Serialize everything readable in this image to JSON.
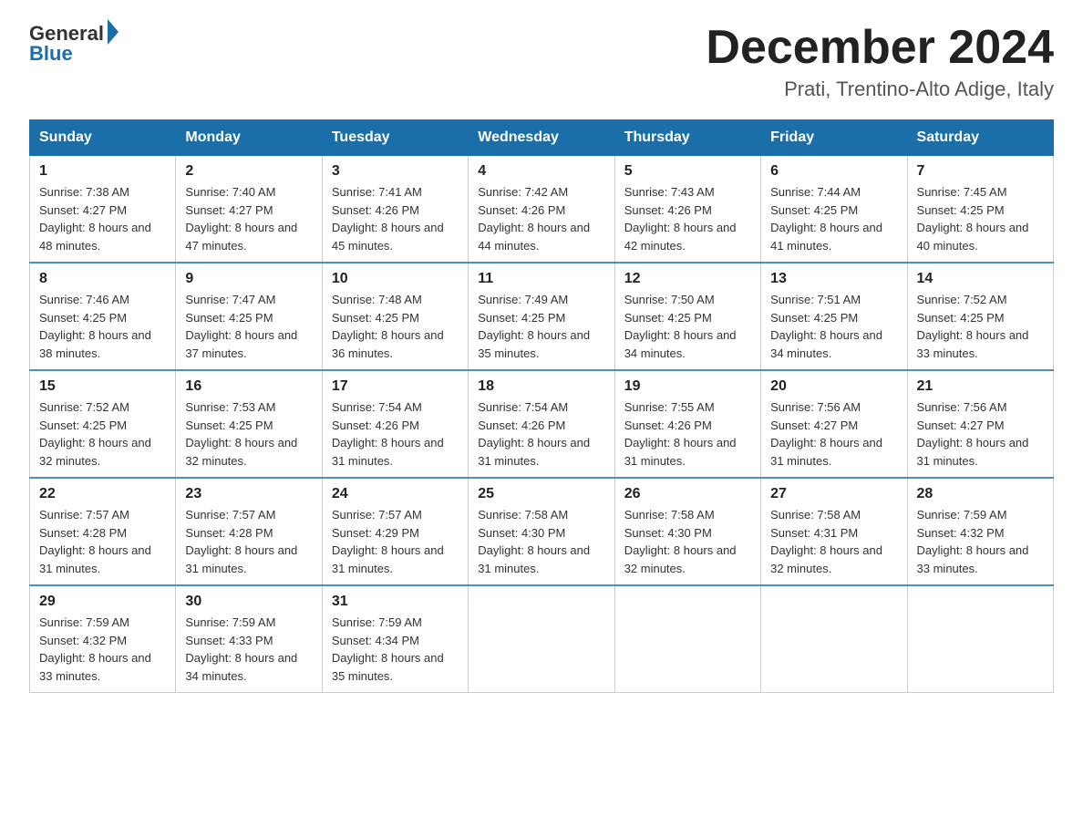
{
  "header": {
    "logo_general": "General",
    "logo_blue": "Blue",
    "month_title": "December 2024",
    "subtitle": "Prati, Trentino-Alto Adige, Italy"
  },
  "days_of_week": [
    "Sunday",
    "Monday",
    "Tuesday",
    "Wednesday",
    "Thursday",
    "Friday",
    "Saturday"
  ],
  "weeks": [
    [
      {
        "day": "1",
        "sunrise": "7:38 AM",
        "sunset": "4:27 PM",
        "daylight": "8 hours and 48 minutes."
      },
      {
        "day": "2",
        "sunrise": "7:40 AM",
        "sunset": "4:27 PM",
        "daylight": "8 hours and 47 minutes."
      },
      {
        "day": "3",
        "sunrise": "7:41 AM",
        "sunset": "4:26 PM",
        "daylight": "8 hours and 45 minutes."
      },
      {
        "day": "4",
        "sunrise": "7:42 AM",
        "sunset": "4:26 PM",
        "daylight": "8 hours and 44 minutes."
      },
      {
        "day": "5",
        "sunrise": "7:43 AM",
        "sunset": "4:26 PM",
        "daylight": "8 hours and 42 minutes."
      },
      {
        "day": "6",
        "sunrise": "7:44 AM",
        "sunset": "4:25 PM",
        "daylight": "8 hours and 41 minutes."
      },
      {
        "day": "7",
        "sunrise": "7:45 AM",
        "sunset": "4:25 PM",
        "daylight": "8 hours and 40 minutes."
      }
    ],
    [
      {
        "day": "8",
        "sunrise": "7:46 AM",
        "sunset": "4:25 PM",
        "daylight": "8 hours and 38 minutes."
      },
      {
        "day": "9",
        "sunrise": "7:47 AM",
        "sunset": "4:25 PM",
        "daylight": "8 hours and 37 minutes."
      },
      {
        "day": "10",
        "sunrise": "7:48 AM",
        "sunset": "4:25 PM",
        "daylight": "8 hours and 36 minutes."
      },
      {
        "day": "11",
        "sunrise": "7:49 AM",
        "sunset": "4:25 PM",
        "daylight": "8 hours and 35 minutes."
      },
      {
        "day": "12",
        "sunrise": "7:50 AM",
        "sunset": "4:25 PM",
        "daylight": "8 hours and 34 minutes."
      },
      {
        "day": "13",
        "sunrise": "7:51 AM",
        "sunset": "4:25 PM",
        "daylight": "8 hours and 34 minutes."
      },
      {
        "day": "14",
        "sunrise": "7:52 AM",
        "sunset": "4:25 PM",
        "daylight": "8 hours and 33 minutes."
      }
    ],
    [
      {
        "day": "15",
        "sunrise": "7:52 AM",
        "sunset": "4:25 PM",
        "daylight": "8 hours and 32 minutes."
      },
      {
        "day": "16",
        "sunrise": "7:53 AM",
        "sunset": "4:25 PM",
        "daylight": "8 hours and 32 minutes."
      },
      {
        "day": "17",
        "sunrise": "7:54 AM",
        "sunset": "4:26 PM",
        "daylight": "8 hours and 31 minutes."
      },
      {
        "day": "18",
        "sunrise": "7:54 AM",
        "sunset": "4:26 PM",
        "daylight": "8 hours and 31 minutes."
      },
      {
        "day": "19",
        "sunrise": "7:55 AM",
        "sunset": "4:26 PM",
        "daylight": "8 hours and 31 minutes."
      },
      {
        "day": "20",
        "sunrise": "7:56 AM",
        "sunset": "4:27 PM",
        "daylight": "8 hours and 31 minutes."
      },
      {
        "day": "21",
        "sunrise": "7:56 AM",
        "sunset": "4:27 PM",
        "daylight": "8 hours and 31 minutes."
      }
    ],
    [
      {
        "day": "22",
        "sunrise": "7:57 AM",
        "sunset": "4:28 PM",
        "daylight": "8 hours and 31 minutes."
      },
      {
        "day": "23",
        "sunrise": "7:57 AM",
        "sunset": "4:28 PM",
        "daylight": "8 hours and 31 minutes."
      },
      {
        "day": "24",
        "sunrise": "7:57 AM",
        "sunset": "4:29 PM",
        "daylight": "8 hours and 31 minutes."
      },
      {
        "day": "25",
        "sunrise": "7:58 AM",
        "sunset": "4:30 PM",
        "daylight": "8 hours and 31 minutes."
      },
      {
        "day": "26",
        "sunrise": "7:58 AM",
        "sunset": "4:30 PM",
        "daylight": "8 hours and 32 minutes."
      },
      {
        "day": "27",
        "sunrise": "7:58 AM",
        "sunset": "4:31 PM",
        "daylight": "8 hours and 32 minutes."
      },
      {
        "day": "28",
        "sunrise": "7:59 AM",
        "sunset": "4:32 PM",
        "daylight": "8 hours and 33 minutes."
      }
    ],
    [
      {
        "day": "29",
        "sunrise": "7:59 AM",
        "sunset": "4:32 PM",
        "daylight": "8 hours and 33 minutes."
      },
      {
        "day": "30",
        "sunrise": "7:59 AM",
        "sunset": "4:33 PM",
        "daylight": "8 hours and 34 minutes."
      },
      {
        "day": "31",
        "sunrise": "7:59 AM",
        "sunset": "4:34 PM",
        "daylight": "8 hours and 35 minutes."
      },
      null,
      null,
      null,
      null
    ]
  ]
}
